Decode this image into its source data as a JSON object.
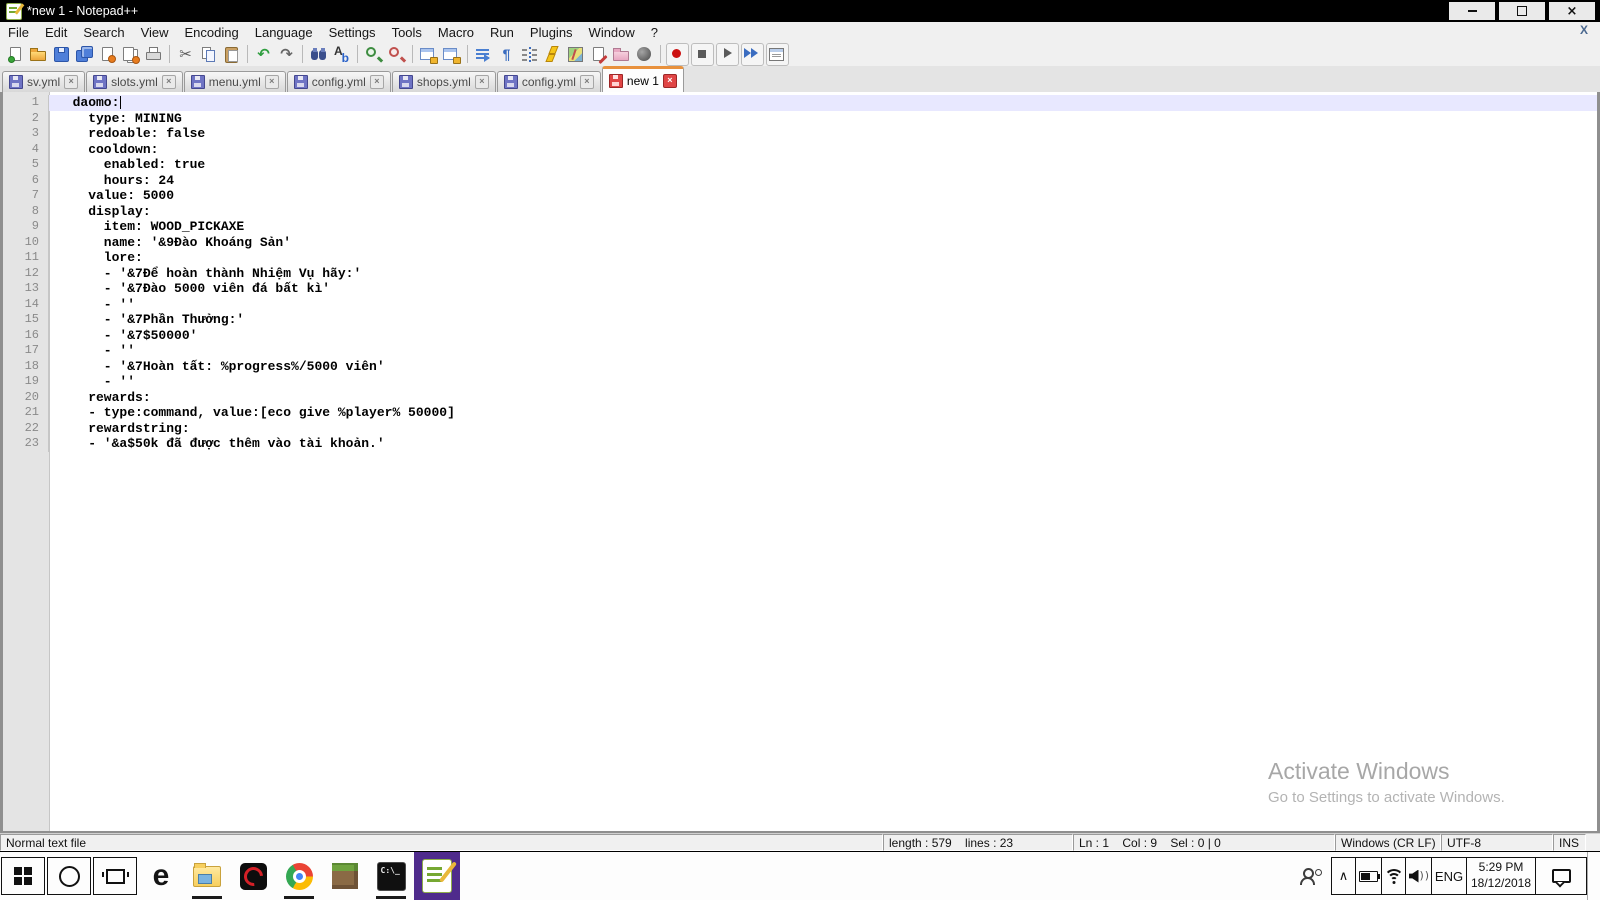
{
  "window": {
    "title": "*new 1 - Notepad++"
  },
  "menu": {
    "items": [
      "File",
      "Edit",
      "Search",
      "View",
      "Encoding",
      "Language",
      "Settings",
      "Tools",
      "Macro",
      "Run",
      "Plugins",
      "Window",
      "?"
    ],
    "close_label": "X"
  },
  "toolbar": {
    "groups": [
      [
        "new-file",
        "open-file",
        "save",
        "save-all",
        "close-file",
        "close-all",
        "print"
      ],
      [
        "cut",
        "copy",
        "paste"
      ],
      [
        "undo",
        "redo"
      ],
      [
        "find",
        "replace"
      ],
      [
        "zoom-in",
        "zoom-out"
      ],
      [
        "sync-vertical",
        "sync-horizontal"
      ],
      [
        "word-wrap",
        "show-all-characters",
        "indent-guide",
        "function-completion",
        "document-map",
        "document-switcher",
        "folder-as-workspace",
        "monitoring"
      ],
      [
        "macro-record",
        "macro-stop",
        "macro-play",
        "macro-run-multiple",
        "macro-save"
      ]
    ]
  },
  "tabs": [
    {
      "label": "sv.yml",
      "active": false,
      "modified": false
    },
    {
      "label": "slots.yml",
      "active": false,
      "modified": false
    },
    {
      "label": "menu.yml",
      "active": false,
      "modified": false
    },
    {
      "label": "config.yml",
      "active": false,
      "modified": false
    },
    {
      "label": "shops.yml",
      "active": false,
      "modified": false
    },
    {
      "label": "config.yml",
      "active": false,
      "modified": false
    },
    {
      "label": "new 1",
      "active": true,
      "modified": true
    }
  ],
  "editor": {
    "current_line": 1,
    "caret_col": 9,
    "lines": [
      "  daomo:",
      "    type: MINING",
      "    redoable: false",
      "    cooldown:",
      "      enabled: true",
      "      hours: 24",
      "    value: 5000",
      "    display:",
      "      item: WOOD_PICKAXE",
      "      name: '&9Đào Khoáng Sản'",
      "      lore:",
      "      - '&7Để hoàn thành Nhiệm Vụ hãy:'",
      "      - '&7Đào 5000 viên đá bất kì'",
      "      - ''",
      "      - '&7Phần Thưởng:'",
      "      - '&7$50000'",
      "      - ''",
      "      - '&7Hoàn tất: %progress%/5000 viên'",
      "      - ''",
      "    rewards:",
      "    - type:command, value:[eco give %player% 50000]",
      "    rewardstring:",
      "    - '&a$50k đã được thêm vào tài khoản.'"
    ]
  },
  "status_bar": {
    "doc_type": "Normal text file",
    "length_info": "length : 579    lines : 23",
    "position_info": "Ln : 1    Col : 9    Sel : 0 | 0",
    "eol": "Windows (CR LF)",
    "encoding": "UTF-8",
    "insert_mode": "INS"
  },
  "taskbar": {
    "apps": [
      {
        "name": "start",
        "open": false,
        "active": false
      },
      {
        "name": "cortana",
        "open": false,
        "active": false
      },
      {
        "name": "task-view",
        "open": false,
        "active": false
      },
      {
        "name": "edge",
        "open": false,
        "active": false
      },
      {
        "name": "file-explorer",
        "open": true,
        "active": false
      },
      {
        "name": "garena",
        "open": false,
        "active": false
      },
      {
        "name": "chrome",
        "open": true,
        "active": false
      },
      {
        "name": "minecraft",
        "open": false,
        "active": false
      },
      {
        "name": "cmd",
        "open": true,
        "active": false
      },
      {
        "name": "notepad-plus-plus",
        "open": true,
        "active": true
      }
    ],
    "tray": {
      "language": "ENG",
      "time": "5:29 PM",
      "date": "18/12/2018"
    }
  },
  "watermark": {
    "line1": "Activate Windows",
    "line2": "Go to Settings to activate Windows."
  },
  "colors": {
    "active_tab_accent": "#e8913d",
    "current_line_bg": "#e8e8ff",
    "taskbar_active_bg": "#4f2b8c",
    "titlebar_bg": "#000000"
  }
}
